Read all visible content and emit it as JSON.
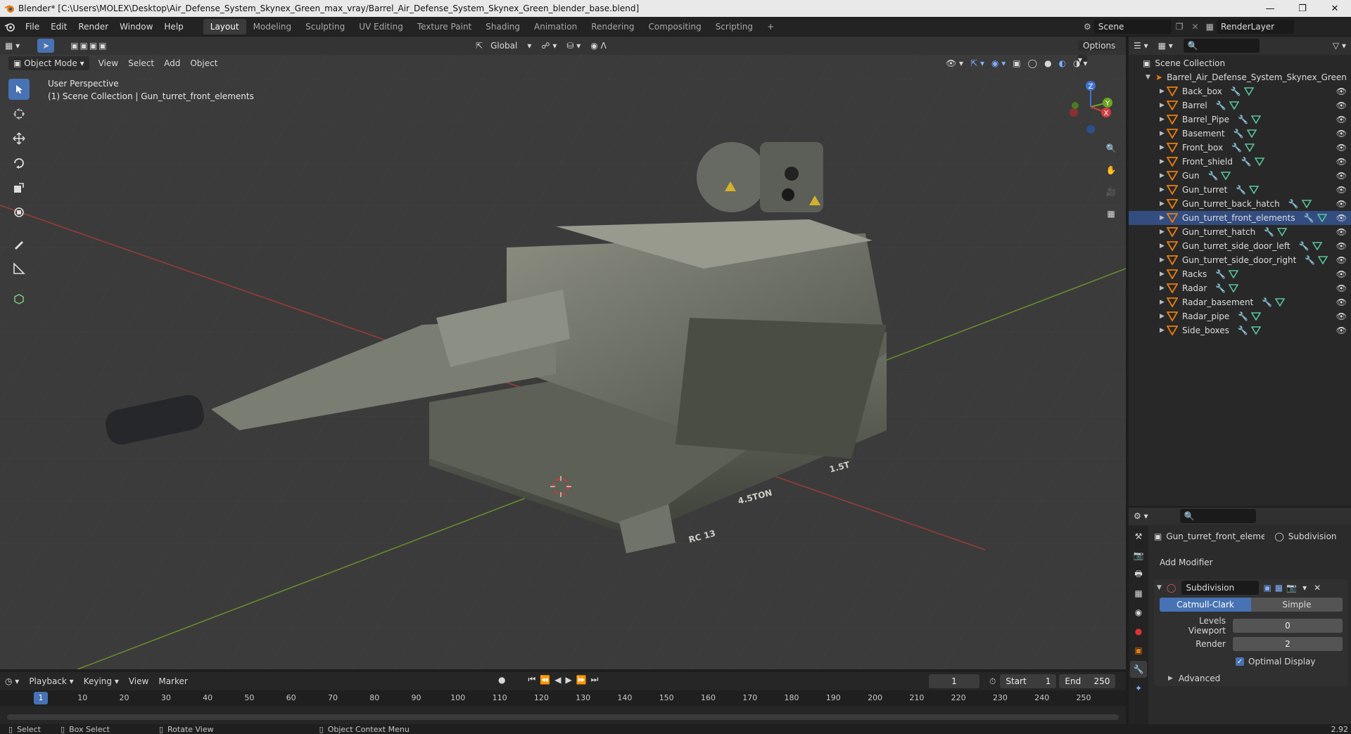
{
  "window": {
    "title": "Blender* [C:\\Users\\MOLEX\\Desktop\\Air_Defense_System_Skynex_Green_max_vray/Barrel_Air_Defense_System_Skynex_Green_blender_base.blend]"
  },
  "menu": [
    "File",
    "Edit",
    "Render",
    "Window",
    "Help"
  ],
  "workspaces": [
    {
      "label": "Layout",
      "active": true
    },
    {
      "label": "Modeling"
    },
    {
      "label": "Sculpting"
    },
    {
      "label": "UV Editing"
    },
    {
      "label": "Texture Paint"
    },
    {
      "label": "Shading"
    },
    {
      "label": "Animation"
    },
    {
      "label": "Rendering"
    },
    {
      "label": "Compositing"
    },
    {
      "label": "Scripting"
    }
  ],
  "scene": {
    "name": "Scene",
    "render_layer": "RenderLayer"
  },
  "viewport": {
    "transform_orientation": "Global",
    "options_label": "Options",
    "mode": "Object Mode",
    "menus": [
      "View",
      "Select",
      "Add",
      "Object"
    ],
    "perspective": "User Perspective",
    "collection_info": "(1) Scene Collection | Gun_turret_front_elements",
    "gizmo_axes": {
      "z": "Z",
      "y": "Y",
      "x": "X"
    }
  },
  "outliner": {
    "root": "Scene Collection",
    "collection": "Barrel_Air_Defense_System_Skynex_Green",
    "items": [
      {
        "name": "Back_box"
      },
      {
        "name": "Barrel"
      },
      {
        "name": "Barrel_Pipe"
      },
      {
        "name": "Basement"
      },
      {
        "name": "Front_box"
      },
      {
        "name": "Front_shield"
      },
      {
        "name": "Gun"
      },
      {
        "name": "Gun_turret"
      },
      {
        "name": "Gun_turret_back_hatch"
      },
      {
        "name": "Gun_turret_front_elements",
        "selected": true
      },
      {
        "name": "Gun_turret_hatch"
      },
      {
        "name": "Gun_turret_side_door_left"
      },
      {
        "name": "Gun_turret_side_door_right"
      },
      {
        "name": "Racks"
      },
      {
        "name": "Radar"
      },
      {
        "name": "Radar_basement"
      },
      {
        "name": "Radar_pipe"
      },
      {
        "name": "Side_boxes"
      }
    ]
  },
  "properties": {
    "object_name": "Gun_turret_front_eleme...",
    "modifier_tab": "Subdivision",
    "add_modifier": "Add Modifier",
    "modifier_name": "Subdivision",
    "algorithm": {
      "options": [
        "Catmull-Clark",
        "Simple"
      ],
      "selected": "Catmull-Clark"
    },
    "levels_viewport_label": "Levels Viewport",
    "levels_viewport": "0",
    "render_label": "Render",
    "render": "2",
    "optimal_display_label": "Optimal Display",
    "optimal_display": true,
    "advanced_label": "Advanced"
  },
  "timeline": {
    "menus": [
      "Playback",
      "Keying",
      "View",
      "Marker"
    ],
    "current_frame": "1",
    "start_label": "Start",
    "start": "1",
    "end_label": "End",
    "end": "250",
    "ruler": [
      "10",
      "20",
      "30",
      "40",
      "50",
      "60",
      "70",
      "80",
      "90",
      "100",
      "110",
      "120",
      "130",
      "140",
      "150",
      "160",
      "170",
      "180",
      "190",
      "200",
      "210",
      "220",
      "230",
      "240",
      "250"
    ],
    "playhead": "1"
  },
  "statusbar": {
    "select": "Select",
    "box_select": "Box Select",
    "rotate_view": "Rotate View",
    "context_menu": "Object Context Menu",
    "version": "2.92"
  }
}
